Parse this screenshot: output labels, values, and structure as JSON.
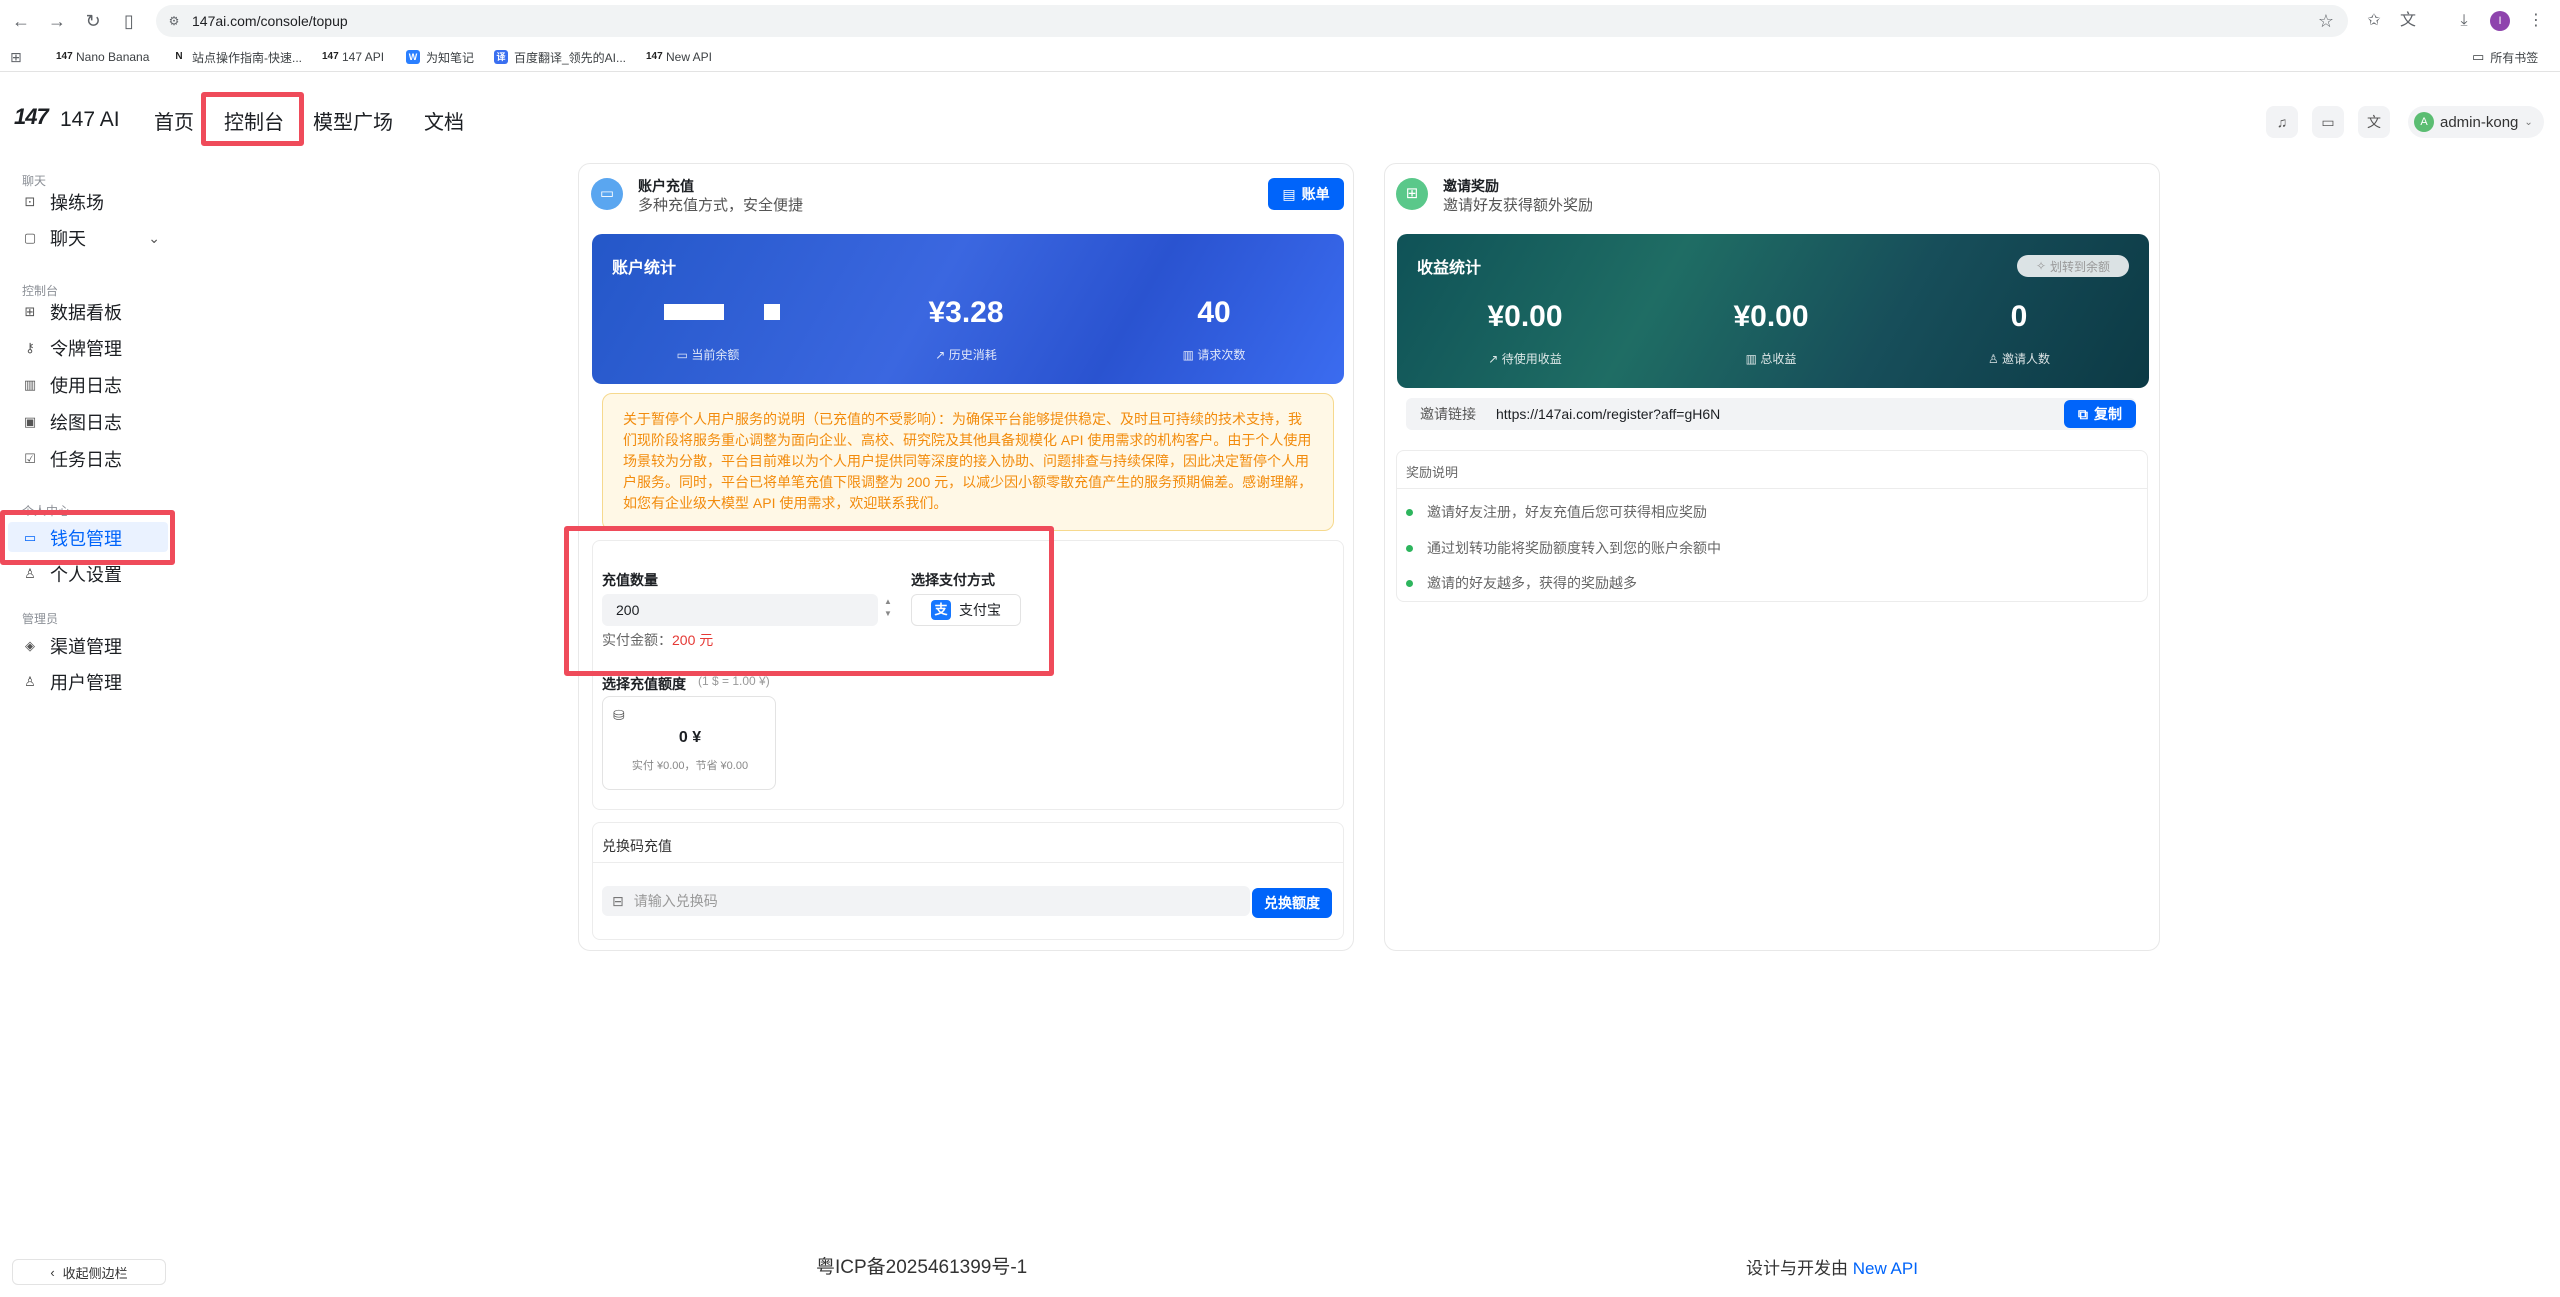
{
  "browser": {
    "url": "147ai.com/console/topup",
    "bookmarks": [
      "Nano Banana",
      "站点操作指南-快速...",
      "147 API",
      "为知笔记",
      "百度翻译_领先的AI...",
      "New API"
    ],
    "all_bookmarks": "所有书签",
    "profile_initial": "I"
  },
  "header": {
    "logo_mark": "147",
    "logo_text": "147 AI",
    "nav": [
      "首页",
      "控制台",
      "模型广场",
      "文档"
    ],
    "user": "admin-kong",
    "user_initial": "A"
  },
  "sidebar": {
    "groups": [
      "聊天",
      "控制台",
      "个人中心",
      "管理员"
    ],
    "items": [
      "操练场",
      "聊天",
      "数据看板",
      "令牌管理",
      "使用日志",
      "绘图日志",
      "任务日志",
      "钱包管理",
      "个人设置",
      "渠道管理",
      "用户管理"
    ],
    "collapse": "收起侧边栏"
  },
  "topup": {
    "title": "账户充值",
    "subtitle": "多种充值方式，安全便捷",
    "bill_button": "账单",
    "stats_title": "账户统计",
    "balance_label": "当前余额",
    "history_value": "¥3.28",
    "history_label": "历史消耗",
    "requests_value": "40",
    "requests_label": "请求次数",
    "notice": "关于暂停个人用户服务的说明（已充值的不受影响）：为确保平台能够提供稳定、及时且可持续的技术支持，我们现阶段将服务重心调整为面向企业、高校、研究院及其他具备规模化 API 使用需求的机构客户。由于个人使用场景较为分散，平台目前难以为个人用户提供同等深度的接入协助、问题排查与持续保障，因此决定暂停个人用户服务。同时，平台已将单笔充值下限调整为 200 元，以减少因小额零散充值产生的服务预期偏差。感谢理解，如您有企业级大模型 API 使用需求，欢迎联系我们。",
    "amount_label": "充值数量",
    "amount_value": "200",
    "pay_method_label": "选择支付方式",
    "alipay": "支付宝",
    "alipay_icon": "支",
    "actual_label": "实付金额：",
    "actual_value": "200 元",
    "preset_label": "选择充值额度",
    "preset_rate": "(1 $ = 1.00 ¥)",
    "preset_amount": "0 ¥",
    "preset_detail": "实付 ¥0.00，节省 ¥0.00",
    "redeem_title": "兑换码充值",
    "redeem_placeholder": "请输入兑换码",
    "redeem_button": "兑换额度"
  },
  "invite": {
    "title": "邀请奖励",
    "subtitle": "邀请好友获得额外奖励",
    "stats_title": "收益统计",
    "transfer_button": "划转到余额",
    "pending_value": "¥0.00",
    "pending_label": "待使用收益",
    "total_value": "¥0.00",
    "total_label": "总收益",
    "invitees_value": "0",
    "invitees_label": "邀请人数",
    "link_label": "邀请链接",
    "link_value": "https://147ai.com/register?aff=gH6N",
    "copy_button": "复制",
    "reward_title": "奖励说明",
    "rewards": [
      "邀请好友注册，好友充值后您可获得相应奖励",
      "通过划转功能将奖励额度转入到您的账户余额中",
      "邀请的好友越多，获得的奖励越多"
    ]
  },
  "footer": {
    "icp": "粤ICP备2025461399号-1",
    "credit_prefix": "设计与开发由",
    "credit_link": "New API"
  },
  "colors": {
    "primary": "#0064fa",
    "highlight": "#ef4b5a",
    "notice_text": "#f28b0c",
    "price_red": "#e53935"
  }
}
